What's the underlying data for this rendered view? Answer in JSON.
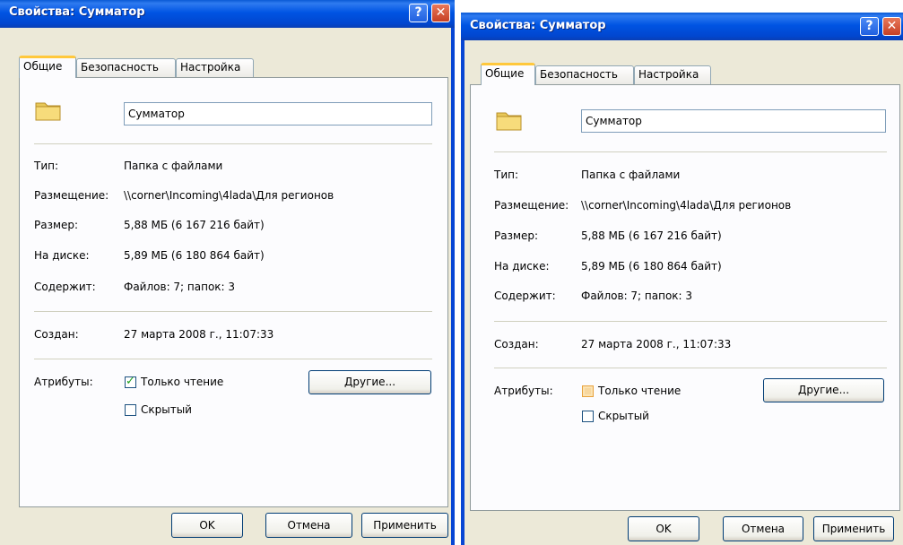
{
  "left": {
    "title": "Свойства: Сумматор",
    "help": "?",
    "close": "✕",
    "tabs": [
      "Общие",
      "Безопасность",
      "Настройка"
    ],
    "name": "Сумматор",
    "type_label": "Тип:",
    "type_value": "Папка с файлами",
    "location_label": "Размещение:",
    "location_value": "\\\\corner\\Incoming\\4lada\\Для регионов",
    "size_label": "Размер:",
    "size_value": "5,88 МБ (6 167 216 байт)",
    "disk_label": "На диске:",
    "disk_value": "5,89 МБ (6 180 864 байт)",
    "contains_label": "Содержит:",
    "contains_value": "Файлов: 7; папок: 3",
    "created_label": "Создан:",
    "created_value": "27 марта 2008 г., 11:07:33",
    "attr_label": "Атрибуты:",
    "readonly": "Только чтение",
    "hidden": "Скрытый",
    "other_btn": "Другие...",
    "ok": "OK",
    "cancel": "Отмена",
    "apply": "Применить"
  },
  "right": {
    "title": "Свойства: Сумматор",
    "help": "?",
    "close": "✕",
    "tabs": [
      "Общие",
      "Безопасность",
      "Настройка"
    ],
    "name": "Сумматор",
    "type_label": "Тип:",
    "type_value": "Папка с файлами",
    "location_label": "Размещение:",
    "location_value": "\\\\corner\\Incoming\\4lada\\Для регионов",
    "size_label": "Размер:",
    "size_value": "5,88 МБ (6 167 216 байт)",
    "disk_label": "На диске:",
    "disk_value": "5,89 МБ (6 180 864 байт)",
    "contains_label": "Содержит:",
    "contains_value": "Файлов: 7; папок: 3",
    "created_label": "Создан:",
    "created_value": "27 марта 2008 г., 11:07:33",
    "attr_label": "Атрибуты:",
    "readonly": "Только чтение",
    "hidden": "Скрытый",
    "other_btn": "Другие...",
    "ok": "OK",
    "cancel": "Отмена",
    "apply": "Применить"
  },
  "state": {
    "left_readonly_checked": true,
    "left_hidden_checked": false,
    "right_readonly_checked": "indeterminate",
    "right_hidden_checked": false
  },
  "colors": {
    "titlebar": "#0054e3",
    "dialog_bg": "#ece9d8",
    "panel_bg": "#fcfcfe",
    "tab_highlight": "#ffc83c"
  }
}
